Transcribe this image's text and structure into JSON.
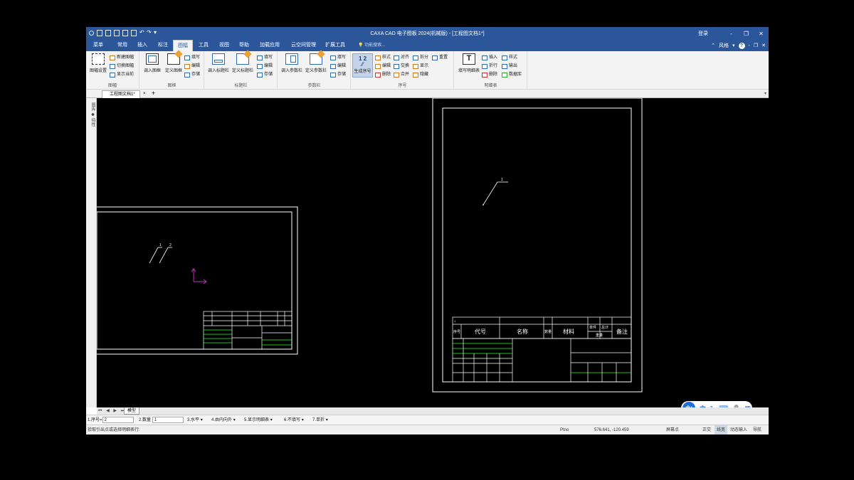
{
  "window": {
    "title": "CAXA CAD 电子图板 2024(机械版) - [工程图文档1*]",
    "login": "登录",
    "min": "-",
    "max": "❐",
    "close": "✕"
  },
  "menu": {
    "tabs": [
      {
        "label": "菜单"
      },
      {
        "label": "常用"
      },
      {
        "label": "插入"
      },
      {
        "label": "标注"
      },
      {
        "label": "图幅",
        "active": true
      },
      {
        "label": "工具"
      },
      {
        "label": "视图"
      },
      {
        "label": "帮助"
      },
      {
        "label": "加载应用"
      },
      {
        "label": "云空间管理"
      },
      {
        "label": "扩展工具"
      }
    ],
    "search": "功能搜索...",
    "style_label": "风格",
    "help_icon": "?"
  },
  "ribbon": {
    "groups": {
      "tufu": "图幅",
      "tukuang": "图框",
      "biaotilan": "标题栏",
      "canshulan": "参数栏",
      "xuhao": "序号",
      "mingxibiao": "明细表"
    },
    "tufu": {
      "big": "图幅设置",
      "new": "新建图幅",
      "switch": "切换图幅",
      "show": "显示当前"
    },
    "tukuang": {
      "insert": "调入图框",
      "define": "定义图框",
      "fill": "填写",
      "edit": "编辑",
      "save": "存储"
    },
    "biaotilan": {
      "insert": "调入标题栏",
      "define": "定义标题栏",
      "fill": "填写",
      "edit": "编辑",
      "save": "存储"
    },
    "canshulan": {
      "insert": "调入参数栏",
      "define": "定义参数栏",
      "fill": "填写",
      "edit": "编辑",
      "save": "存储"
    },
    "xuhao": {
      "big_top": "1 2",
      "big": "生成序号",
      "style": "样式",
      "edit": "编辑",
      "delete": "删除",
      "align": "对齐",
      "exchange": "交换",
      "merge": "合并",
      "split": "拆分",
      "show": "显示",
      "hide": "隐藏",
      "reset": "重置"
    },
    "mingxibiao": {
      "big": "填写明细表",
      "insert": "插入",
      "fold": "折行",
      "delete": "删除",
      "style": "样式",
      "output": "输出",
      "database": "数据库"
    }
  },
  "doc": {
    "tab": "工程图文档1*",
    "close": "×",
    "add": "+"
  },
  "side_panel": {
    "label": "图库 ◆ 特性"
  },
  "model": {
    "nav": "⏮ ◀ ▶ ⏭",
    "tab": "模型"
  },
  "ime": {
    "logo": "du",
    "lang": "中",
    "punct": "°,",
    "board": "⌨",
    "user": "👤",
    "grid": "▦"
  },
  "params": [
    {
      "label": "1.序号=",
      "value": "2"
    },
    {
      "label": "2.数量",
      "value": "1"
    },
    {
      "label": "3.水平",
      "dropdown": true
    },
    {
      "label": "4.由内向外",
      "dropdown": true
    },
    {
      "label": "5.显示明细表",
      "dropdown": true
    },
    {
      "label": "6.不填写",
      "dropdown": true
    },
    {
      "label": "7.单折",
      "dropdown": true
    }
  ],
  "status": {
    "prompt": "拾取引出点或选择明细表行:",
    "ptno": "Ptno",
    "coords": "576.641, -120.459",
    "snap": "屏幕点",
    "ortho": "正交",
    "linewidth": "线宽",
    "dynamic": "动态输入",
    "nav": "导航"
  },
  "drawing": {
    "balloon_left": "1",
    "balloon_left2": "2",
    "balloon_right": "1",
    "title_block_headers": [
      "序号",
      "代号",
      "名称",
      "数量",
      "材料",
      "单件",
      "总计",
      "重量",
      "备注"
    ],
    "tb_row_label": "1"
  }
}
